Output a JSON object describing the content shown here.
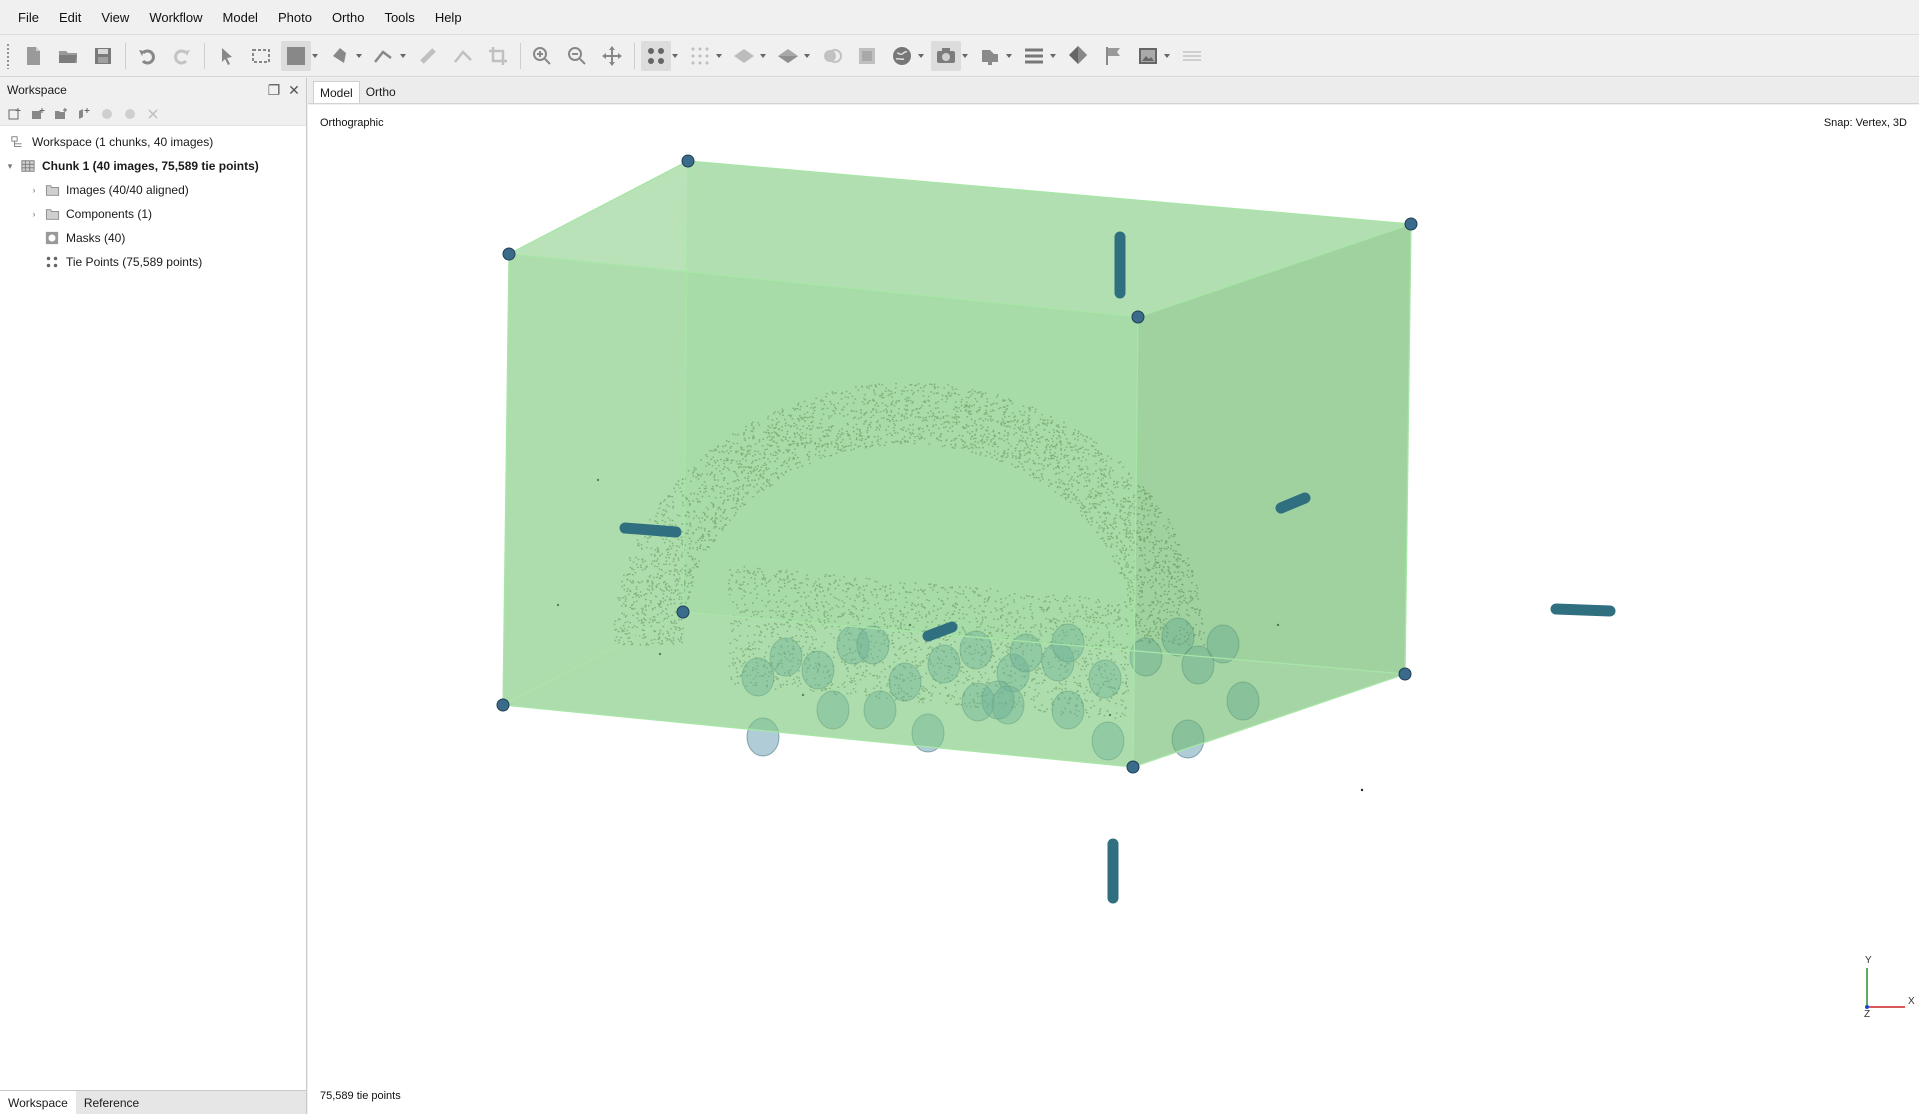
{
  "menu": [
    "File",
    "Edit",
    "View",
    "Workflow",
    "Model",
    "Photo",
    "Ortho",
    "Tools",
    "Help"
  ],
  "toolbar": {
    "icons": [
      "new-file-icon",
      "open-folder-icon",
      "save-icon",
      "undo-icon",
      "redo-icon",
      "pointer-icon",
      "rect-select-icon",
      "region-icon",
      "polygon-icon",
      "ruler-icon",
      "shape-icon",
      "erase-icon",
      "crop-icon",
      "zoom-in-icon",
      "zoom-out-icon",
      "navigate-icon",
      "points-icon",
      "grid-icon",
      "surface-icon",
      "solid-icon",
      "markers-icon",
      "texture-icon",
      "globe-icon",
      "camera-icon",
      "shapes-icon",
      "menu-icon",
      "ortho-icon",
      "flag-icon",
      "image-icon",
      "layers-icon"
    ]
  },
  "workspace_panel": {
    "title": "Workspace",
    "tree": [
      {
        "label": "Workspace (1 chunks, 40 images)",
        "icon": "workspace-icon",
        "arrow": "",
        "indent": 0,
        "bold": false
      },
      {
        "label": "Chunk 1 (40 images, 75,589 tie points)",
        "icon": "chunk-icon",
        "arrow": "▾",
        "indent": 0,
        "bold": true
      },
      {
        "label": "Images (40/40 aligned)",
        "icon": "folder-icon",
        "arrow": "›",
        "indent": 1,
        "bold": false
      },
      {
        "label": "Components (1)",
        "icon": "folder-icon",
        "arrow": "›",
        "indent": 1,
        "bold": false
      },
      {
        "label": "Masks (40)",
        "icon": "mask-icon",
        "arrow": "",
        "indent": 1,
        "bold": false
      },
      {
        "label": "Tie Points (75,589 points)",
        "icon": "tiepoints-icon",
        "arrow": "",
        "indent": 1,
        "bold": false
      }
    ],
    "bottom_tabs": [
      "Workspace",
      "Reference"
    ]
  },
  "view_tabs": [
    "Model",
    "Ortho"
  ],
  "viewport": {
    "projection": "Orthographic",
    "snap": "Snap: Vertex, 3D",
    "status": "75,589 tie points",
    "axis_labels": {
      "y": "Y",
      "x": "X",
      "z": "Z"
    },
    "region_color": "#8bcf8b",
    "point_color": "#3d5a2e",
    "camera_color": "#4f8fa6",
    "handle_color": "#2f6f7f"
  }
}
